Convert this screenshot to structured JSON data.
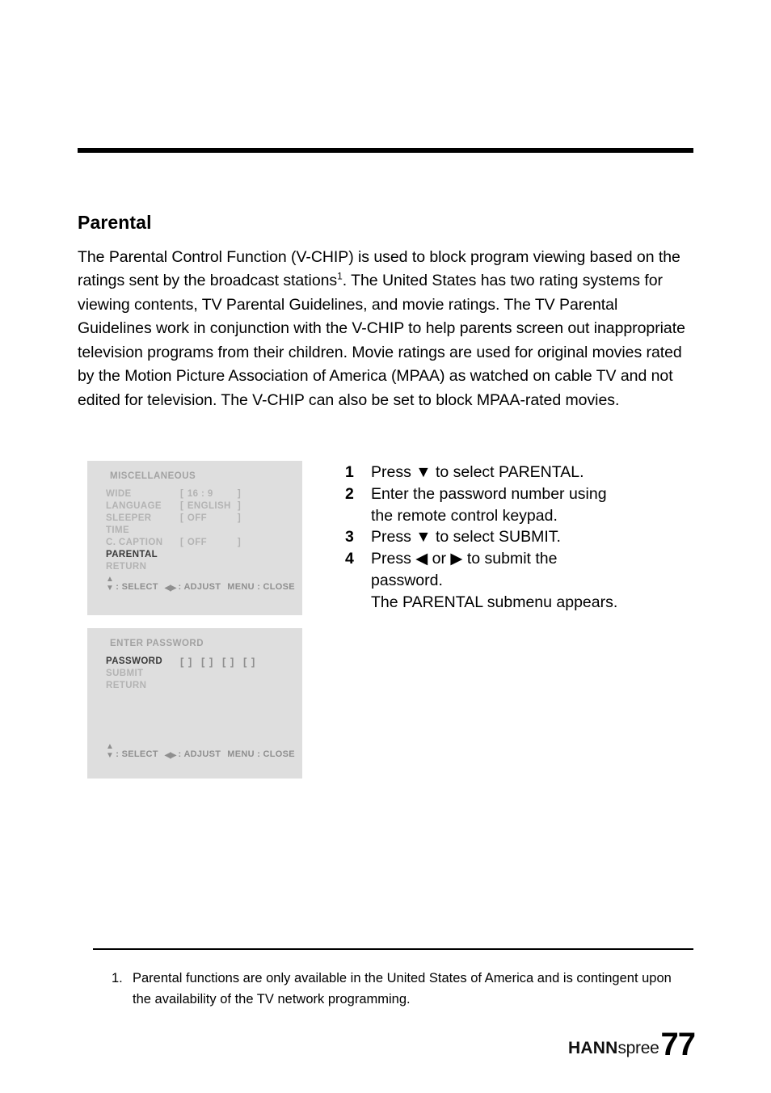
{
  "document": {
    "section_title": "Parental",
    "intro_paragraph": "The Parental Control Function (V-CHIP) is used to block program viewing based on the ratings sent by the broadcast stations",
    "intro_superscript": "1",
    "intro_paragraph_rest": ". The United States has two rating systems for viewing contents, TV Parental Guidelines, and movie ratings. The TV Parental Guidelines work in conjunction with the V-CHIP to help parents screen out inappropriate television programs from their children. Movie ratings are used for original movies rated by the Motion Picture Association of America (MPAA) as watched on cable TV and not edited for television. The V-CHIP can also be set to block MPAA-rated movies."
  },
  "osd_miscellaneous": {
    "title": "MISCELLANEOUS",
    "rows": [
      {
        "label": "WIDE",
        "bracket_left": "[",
        "value": "16 : 9",
        "bracket_right": "]",
        "selected": false
      },
      {
        "label": "LANGUAGE",
        "bracket_left": "[",
        "value": "ENGLISH",
        "bracket_right": "]",
        "selected": false
      },
      {
        "label": "SLEEPER",
        "bracket_left": "[",
        "value": "OFF",
        "bracket_right": "]",
        "selected": false
      },
      {
        "label": "TIME",
        "bracket_left": "",
        "value": "",
        "bracket_right": "",
        "selected": false
      },
      {
        "label": "C. CAPTION",
        "bracket_left": "[",
        "value": "OFF",
        "bracket_right": "]",
        "selected": false
      },
      {
        "label": "PARENTAL",
        "bracket_left": "",
        "value": "",
        "bracket_right": "",
        "selected": true
      },
      {
        "label": "RETURN",
        "bracket_left": "",
        "value": "",
        "bracket_right": "",
        "selected": false
      }
    ],
    "status": {
      "select_icon": "up-down-arrow-icon",
      "select_label": ": SELECT",
      "adjust_icon": "left-right-arrow-icon",
      "adjust_label": ": ADJUST",
      "close_label": "MENU : CLOSE"
    }
  },
  "osd_password": {
    "title": "ENTER PASSWORD",
    "rows": [
      {
        "label": "PASSWORD",
        "selected": true,
        "digits": [
          "[  ]",
          "[  ]",
          "[  ]",
          "[  ]"
        ]
      },
      {
        "label": "SUBMIT",
        "selected": false,
        "digits": []
      },
      {
        "label": "RETURN",
        "selected": false,
        "digits": []
      }
    ],
    "status": {
      "select_icon": "up-down-arrow-icon",
      "select_label": ": SELECT",
      "adjust_icon": "left-right-arrow-icon",
      "adjust_label": ": ADJUST",
      "close_label": "MENU : CLOSE"
    }
  },
  "steps": [
    {
      "number": "1",
      "lines": [
        "Press ▼ to select PARENTAL."
      ]
    },
    {
      "number": "2",
      "lines": [
        "Enter the password number using",
        "the remote control keypad."
      ]
    },
    {
      "number": "3",
      "lines": [
        "Press ▼ to select SUBMIT."
      ]
    },
    {
      "number": "4",
      "lines": [
        "Press ◀ or ▶ to submit the",
        "password.",
        "The PARENTAL submenu appears."
      ]
    }
  ],
  "footnote": {
    "number": "1.",
    "text": "Parental functions are only available in the United States of America and is contingent upon the availability of the TV network programming."
  },
  "footer": {
    "brand_bold": "HANN",
    "brand_light": "spree",
    "page_number": "77"
  },
  "colors": {
    "osd_background": "#dedede",
    "osd_dim_text": "#b3b3b3",
    "osd_title_text": "#a2a2a2",
    "osd_selected_text": "#3a3a3a",
    "rule": "#000000"
  }
}
